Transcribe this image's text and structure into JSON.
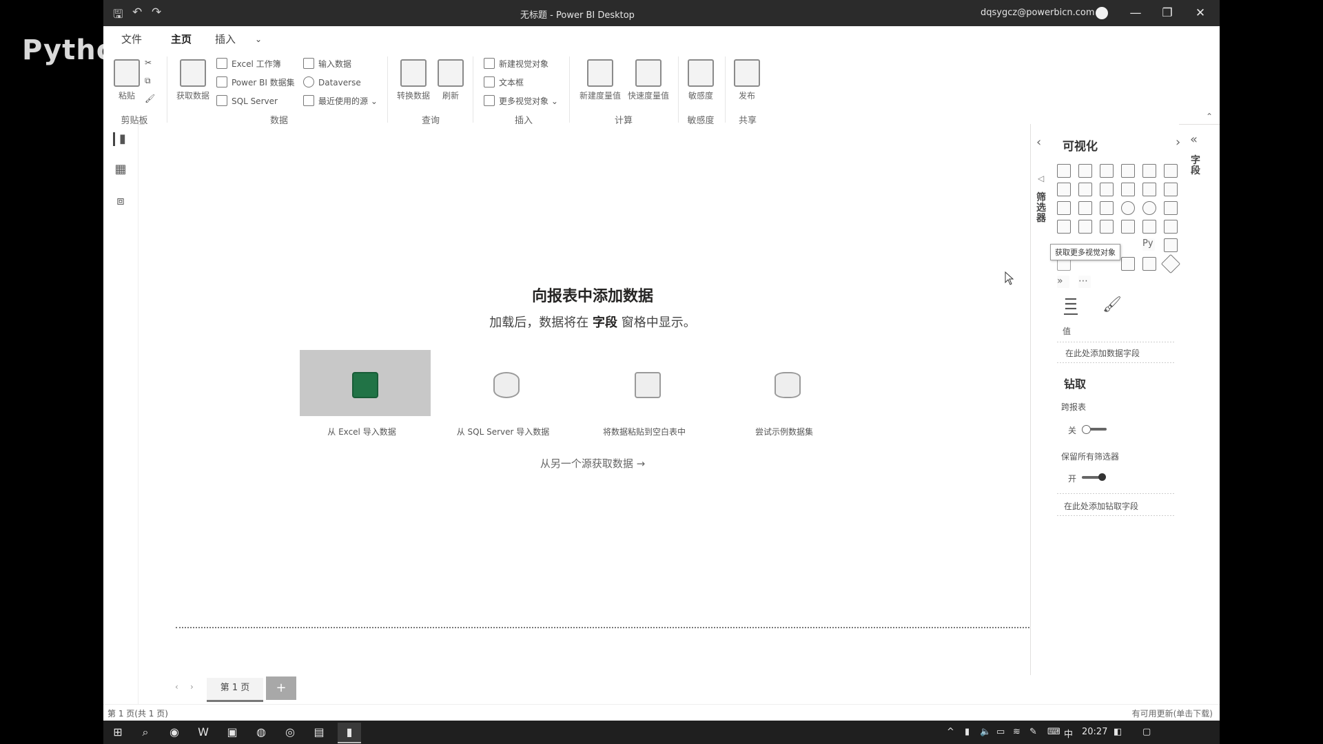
{
  "watermark": "Python",
  "titlebar": {
    "title": "无标题 - Power BI Desktop",
    "user": "dqsygcz@powerbicn.com",
    "min": "—",
    "restore": "❐",
    "close": "✕"
  },
  "ribbon": {
    "tabs": [
      "文件",
      "主页",
      "插入"
    ],
    "clipboard": {
      "paste": "粘贴",
      "group": "剪贴板"
    },
    "data": {
      "get_data": "获取数据",
      "excel": "Excel 工作簿",
      "pbi_dataset": "Power BI 数据集",
      "sql": "SQL Server",
      "enter_data": "输入数据",
      "dataverse": "Dataverse",
      "recent": "最近使用的源",
      "group": "数据"
    },
    "query": {
      "transform": "转换数据",
      "refresh": "刷新",
      "group": "查询"
    },
    "insert": {
      "new_visual": "新建视觉对象",
      "textbox": "文本框",
      "more_visuals": "更多视觉对象",
      "group": "插入"
    },
    "calc": {
      "new_measure": "新建度量值",
      "quick_measure": "快速度量值",
      "group": "计算"
    },
    "sensitivity": {
      "label": "敏感度",
      "group": "敏感度"
    },
    "share": {
      "publish": "发布",
      "group": "共享"
    }
  },
  "canvas": {
    "title": "向报表中添加数据",
    "subtitle_pre": "加载后，数据将在",
    "subtitle_bold": "字段",
    "subtitle_post": "窗格中显示。",
    "cards": [
      {
        "label": "从 Excel 导入数据"
      },
      {
        "label": "从 SQL Server 导入数据"
      },
      {
        "label": "将数据粘贴到空白表中"
      },
      {
        "label": "尝试示例数据集"
      }
    ],
    "other_source": "从另一个源获取数据 →"
  },
  "pages": {
    "tab": "第 1 页",
    "add": "+",
    "status": "第 1 页(共 1 页)"
  },
  "status_right": "有可用更新(单击下载)",
  "viz_pane": {
    "title": "可视化",
    "filters_vertical": "筛选器",
    "fields_vertical": "字段",
    "tooltip": "获取更多视觉对象",
    "values_label": "值",
    "values_placeholder": "在此处添加数据字段",
    "drill_header": "钻取",
    "cross_report": "跨报表",
    "off": "关",
    "keep_filters": "保留所有筛选器",
    "on": "开",
    "drill_placeholder": "在此处添加钻取字段"
  },
  "taskbar": {
    "lang": "中",
    "time": "20:27"
  }
}
